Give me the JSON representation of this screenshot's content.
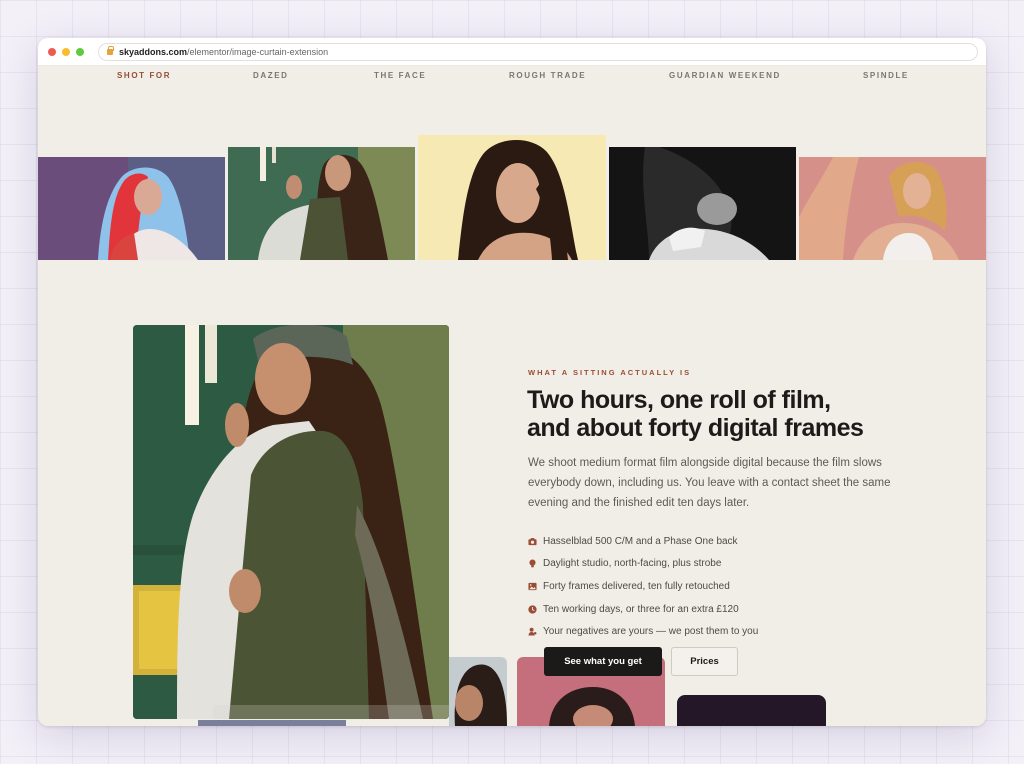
{
  "browser": {
    "url_host": "skyaddons.com",
    "url_path": "/elementor/image-curtain-extension"
  },
  "shot_for": {
    "label": "SHOT FOR",
    "publications": [
      "DAZED",
      "THE FACE",
      "ROUGH TRADE",
      "GUARDIAN WEEKEND",
      "SPINDLE"
    ]
  },
  "section": {
    "eyebrow": "WHAT A SITTING ACTUALLY IS",
    "headline_line1": "Two hours, one roll of film,",
    "headline_line2": "and about forty digital frames",
    "body": "We shoot medium format film alongside digital because the film slows everybody down, including us. You leave with a contact sheet the same evening and the finished edit ten days later.",
    "features": [
      {
        "icon": "camera-icon",
        "text": "Hasselblad 500 C/M and a Phase One back"
      },
      {
        "icon": "lightbulb-icon",
        "text": "Daylight studio, north-facing, plus strobe"
      },
      {
        "icon": "image-icon",
        "text": "Forty frames delivered, ten fully retouched"
      },
      {
        "icon": "clock-icon",
        "text": "Ten working days, or three for an extra £120"
      },
      {
        "icon": "user-icon",
        "text": "Your negatives are yours — we post them to you"
      }
    ],
    "primary_button": "See what you get",
    "secondary_button": "Prices"
  },
  "colors": {
    "accent": "#9b4c35",
    "page_bg": "#f1ede7",
    "ink": "#1d1b1a"
  }
}
